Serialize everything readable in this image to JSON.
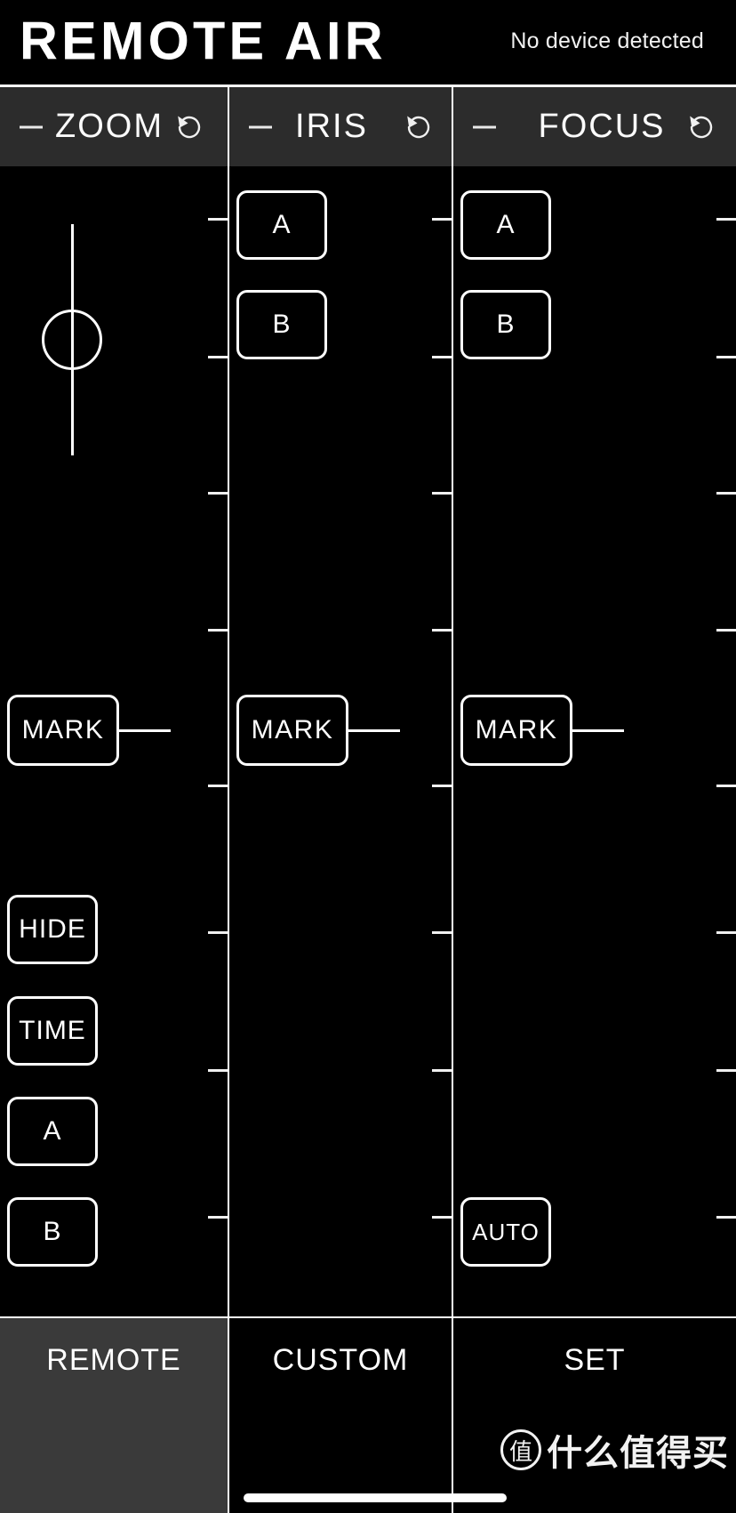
{
  "header": {
    "logo": "REMOTE AIR",
    "device_status": "No device detected"
  },
  "columns": [
    {
      "id": "zoom",
      "title": "ZOOM",
      "minus_icon": "minus-icon",
      "reset_icon": "reset-rotate-ccw-icon",
      "slider": {
        "handle_icon": "slider-knob-circle",
        "position_percent": 50
      },
      "buttons": [
        {
          "label": "MARK",
          "name": "zoom-mark-button"
        },
        {
          "label": "HIDE",
          "name": "zoom-hide-button"
        },
        {
          "label": "TIME",
          "name": "zoom-time-button"
        },
        {
          "label": "A",
          "name": "zoom-a-button"
        },
        {
          "label": "B",
          "name": "zoom-b-button"
        }
      ]
    },
    {
      "id": "iris",
      "title": "IRIS",
      "minus_icon": "minus-icon",
      "reset_icon": "reset-rotate-ccw-icon",
      "buttons": [
        {
          "label": "A",
          "name": "iris-a-button"
        },
        {
          "label": "B",
          "name": "iris-b-button"
        },
        {
          "label": "MARK",
          "name": "iris-mark-button"
        }
      ]
    },
    {
      "id": "focus",
      "title": "FOCUS",
      "minus_icon": "minus-icon",
      "reset_icon": "reset-rotate-ccw-icon",
      "buttons": [
        {
          "label": "A",
          "name": "focus-a-button"
        },
        {
          "label": "B",
          "name": "focus-b-button"
        },
        {
          "label": "MARK",
          "name": "focus-mark-button"
        },
        {
          "label": "AUTO",
          "name": "focus-auto-button"
        }
      ]
    }
  ],
  "tabs": [
    {
      "label": "REMOTE",
      "active": true
    },
    {
      "label": "CUSTOM",
      "active": false
    },
    {
      "label": "SET",
      "active": false
    }
  ],
  "watermark": {
    "badge": "值",
    "text": "什么值得买"
  },
  "colors": {
    "background": "#000000",
    "header_bar": "#2c2c2c",
    "active_tab": "#3a3a3a",
    "line": "#ffffff",
    "text": "#ffffff"
  }
}
